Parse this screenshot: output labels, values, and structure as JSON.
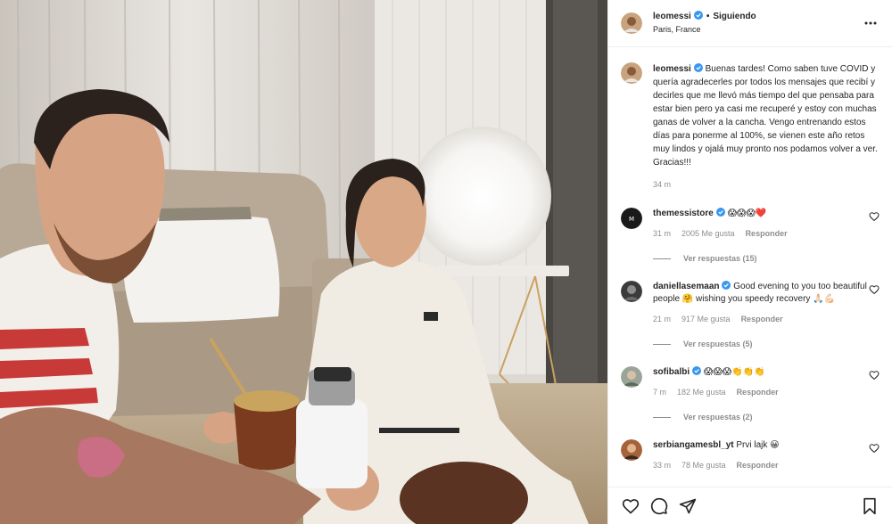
{
  "post": {
    "username": "leomessi",
    "follow_state": "Siguiendo",
    "location": "Paris, France",
    "separator": "•"
  },
  "caption": {
    "username": "leomessi",
    "text": "Buenas tardes! Como saben tuve COVID y quería agradecerles por todos los mensajes que recibí y decirles que me llevó más tiempo del que pensaba para estar bien pero ya casi me recuperé y estoy con muchas ganas de volver a la cancha. Vengo entrenando estos días para ponerme al 100%, se vienen este año retos muy lindos y ojalá muy pronto nos podamos volver a ver. Gracias!!!",
    "time": "34 m"
  },
  "comments": [
    {
      "username": "themessistore",
      "text": "😱😱😱❤️",
      "time": "31 m",
      "likes": "2005 Me gusta",
      "reply_label": "Responder",
      "view_replies": "Ver respuestas (15)"
    },
    {
      "username": "daniellasemaan",
      "text": "Good evening to you too beautiful people 🤗 wishing you speedy recovery 🙏🏻💪🏻",
      "time": "21 m",
      "likes": "917 Me gusta",
      "reply_label": "Responder",
      "view_replies": "Ver respuestas (5)"
    },
    {
      "username": "sofibalbi",
      "text": "😱😱😱👏👏👏",
      "time": "7 m",
      "likes": "182 Me gusta",
      "reply_label": "Responder",
      "view_replies": "Ver respuestas (2)"
    },
    {
      "username": "serbiangamesbl_yt",
      "text": "Prvi lajk 😀",
      "time": "33 m",
      "likes": "78 Me gusta",
      "reply_label": "Responder"
    }
  ],
  "icons": {
    "more": "more-dots-icon",
    "verified": "verified-badge-icon",
    "like": "heart-icon",
    "comment": "comment-icon",
    "share": "share-icon",
    "save": "bookmark-icon"
  },
  "colors": {
    "verified": "#3897f0",
    "text": "#262626",
    "muted": "#8e8e8e",
    "border": "#efefef"
  }
}
